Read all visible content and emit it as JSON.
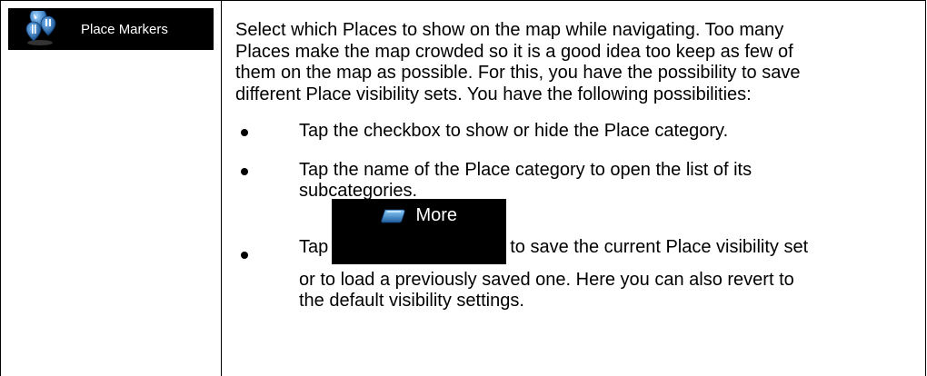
{
  "menu_button": {
    "label": "Place Markers",
    "icon": "place-markers-icon"
  },
  "description": {
    "lines": [
      "Select which Places to show on the map while navigating. Too many",
      "Places make the map crowded so it is a good idea too keep as few of",
      "them on the map as possible. For this, you have the possibility to save",
      "different Place visibility sets. You have the following possibilities:"
    ]
  },
  "bullets": {
    "b1": "Tap the checkbox to show or hide the Place category.",
    "b2_line1": "Tap the name of the Place category to open the list of its",
    "b2_line2": "subcategories.",
    "b3_prefix": "Tap",
    "b3_suffix": "to save the current Place visibility set",
    "b3_line2": "or to load a previously saved one. Here you can also revert to",
    "b3_line3": "the default visibility settings."
  },
  "more_button": {
    "label": "More",
    "icon": "more-icon",
    "icon_color": "#2a6fb0"
  }
}
